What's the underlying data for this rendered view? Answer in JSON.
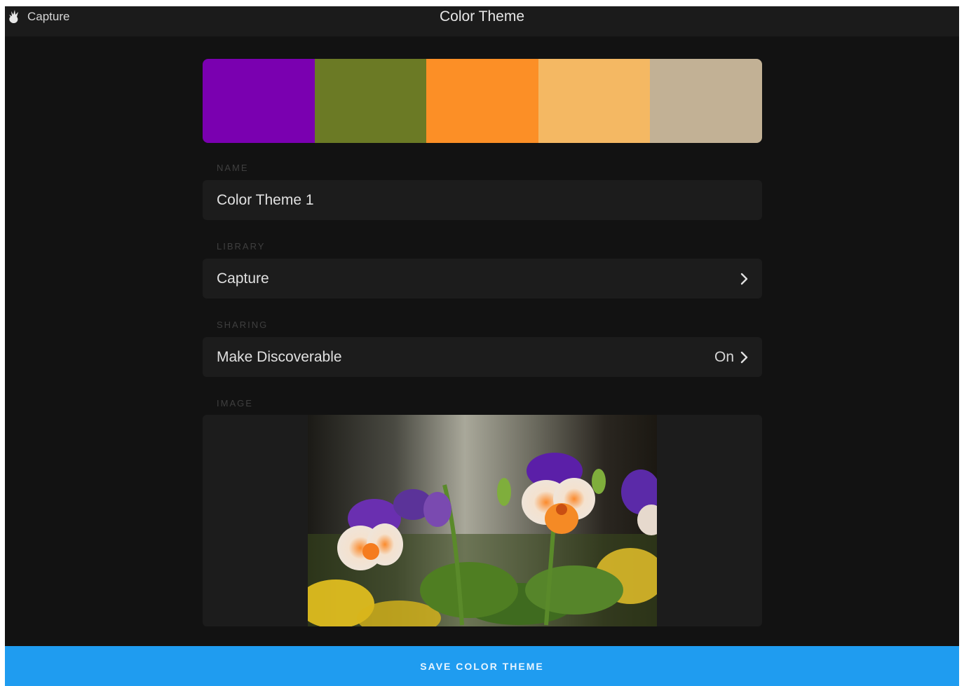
{
  "header": {
    "back_label": "Capture",
    "back_icon": "capture-hand-icon",
    "title": "Color Theme"
  },
  "palette": {
    "swatches": [
      "#7a00b0",
      "#6b7a25",
      "#fc8f26",
      "#f4b863",
      "#c2b195"
    ]
  },
  "form": {
    "name": {
      "label": "NAME",
      "value": "Color Theme 1"
    },
    "library": {
      "label": "LIBRARY",
      "value": "Capture",
      "icon": "chevron-right-icon"
    },
    "sharing": {
      "label": "SHARING",
      "value": "Make Discoverable",
      "status": "On",
      "icon": "chevron-right-icon"
    },
    "image": {
      "label": "IMAGE"
    }
  },
  "footer": {
    "save_label": "SAVE COLOR THEME",
    "color": "#1f9cf0"
  }
}
